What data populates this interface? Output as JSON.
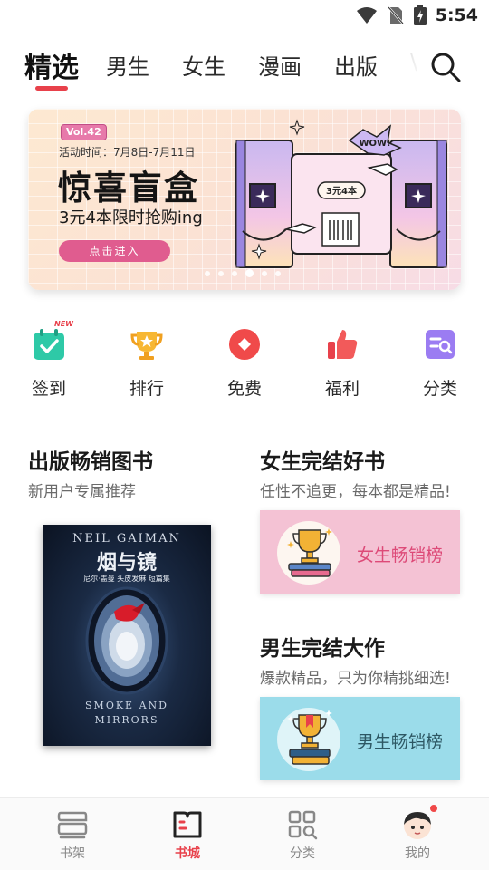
{
  "status_bar": {
    "time": "5:54"
  },
  "top_tabs": [
    {
      "label": "精选",
      "active": true
    },
    {
      "label": "男生",
      "active": false
    },
    {
      "label": "女生",
      "active": false
    },
    {
      "label": "漫画",
      "active": false
    },
    {
      "label": "出版",
      "active": false
    },
    {
      "label": "\\",
      "active": false
    }
  ],
  "banner": {
    "vol": "Vol.42",
    "date": "活动时间：7月8日-7月11日",
    "title": "惊喜盲盒",
    "subtitle": "3元4本限时抢购ing",
    "button": "点击进入",
    "art_tag": "3元4本",
    "art_bubble": "WOW!",
    "active_slide": 3,
    "slide_count": 6
  },
  "quick_entries": [
    {
      "label": "签到",
      "icon": "calendar-check-icon",
      "badge": "NEW"
    },
    {
      "label": "排行",
      "icon": "trophy-icon"
    },
    {
      "label": "免费",
      "icon": "free-diamond-icon"
    },
    {
      "label": "福利",
      "icon": "thumbs-up-icon"
    },
    {
      "label": "分类",
      "icon": "category-search-icon"
    }
  ],
  "publish_section": {
    "title": "出版畅销图书",
    "subtitle": "新用户专属推荐",
    "book": {
      "author_en": "NEIL GAIMAN",
      "title_cn": "烟与镜",
      "subtitle_cn": "尼尔·盖曼 头皮发麻 短篇集",
      "title_en_1": "SMOKE AND",
      "title_en_2": "MIRRORS"
    }
  },
  "female_section": {
    "title": "女生完结好书",
    "subtitle": "任性不追更，每本都是精品!",
    "card_label": "女生畅销榜"
  },
  "male_section": {
    "title": "男生完结大作",
    "subtitle": "爆款精品，只为你精挑细选!",
    "card_label": "男生畅销榜"
  },
  "bottom_nav": [
    {
      "label": "书架",
      "icon": "bookshelf-icon",
      "active": false
    },
    {
      "label": "书城",
      "icon": "bookstore-icon",
      "active": true
    },
    {
      "label": "分类",
      "icon": "category-grid-icon",
      "active": false
    },
    {
      "label": "我的",
      "icon": "avatar-icon",
      "active": false,
      "dot": true
    }
  ],
  "colors": {
    "accent": "#e8414b",
    "female_card": "#f4c2d4",
    "male_card": "#9bdcea",
    "banner_button": "#e05c8f"
  }
}
